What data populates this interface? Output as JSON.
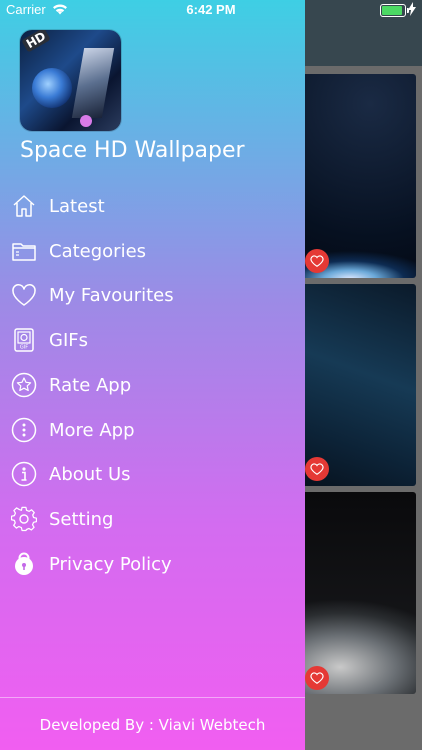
{
  "status_bar": {
    "carrier": "Carrier",
    "time": "6:42 PM"
  },
  "drawer": {
    "app_title": "Space HD Wallpaper",
    "logo_badge": "HD",
    "menu": [
      {
        "label": "Latest",
        "icon": "home-icon"
      },
      {
        "label": "Categories",
        "icon": "folder-icon"
      },
      {
        "label": "My Favourites",
        "icon": "heart-icon"
      },
      {
        "label": "GIFs",
        "icon": "gif-icon"
      },
      {
        "label": "Rate App",
        "icon": "star-icon"
      },
      {
        "label": "More App",
        "icon": "more-icon"
      },
      {
        "label": "About Us",
        "icon": "info-icon"
      },
      {
        "label": "Setting",
        "icon": "gear-icon"
      },
      {
        "label": "Privacy Policy",
        "icon": "lock-icon"
      }
    ],
    "footer": "Developed By : Viavi Webtech"
  },
  "colors": {
    "drawer_gradient_top": "#3ecfe4",
    "drawer_gradient_bottom": "#f15ef1",
    "favourite_button": "#e53935",
    "background_header": "#37474f"
  }
}
